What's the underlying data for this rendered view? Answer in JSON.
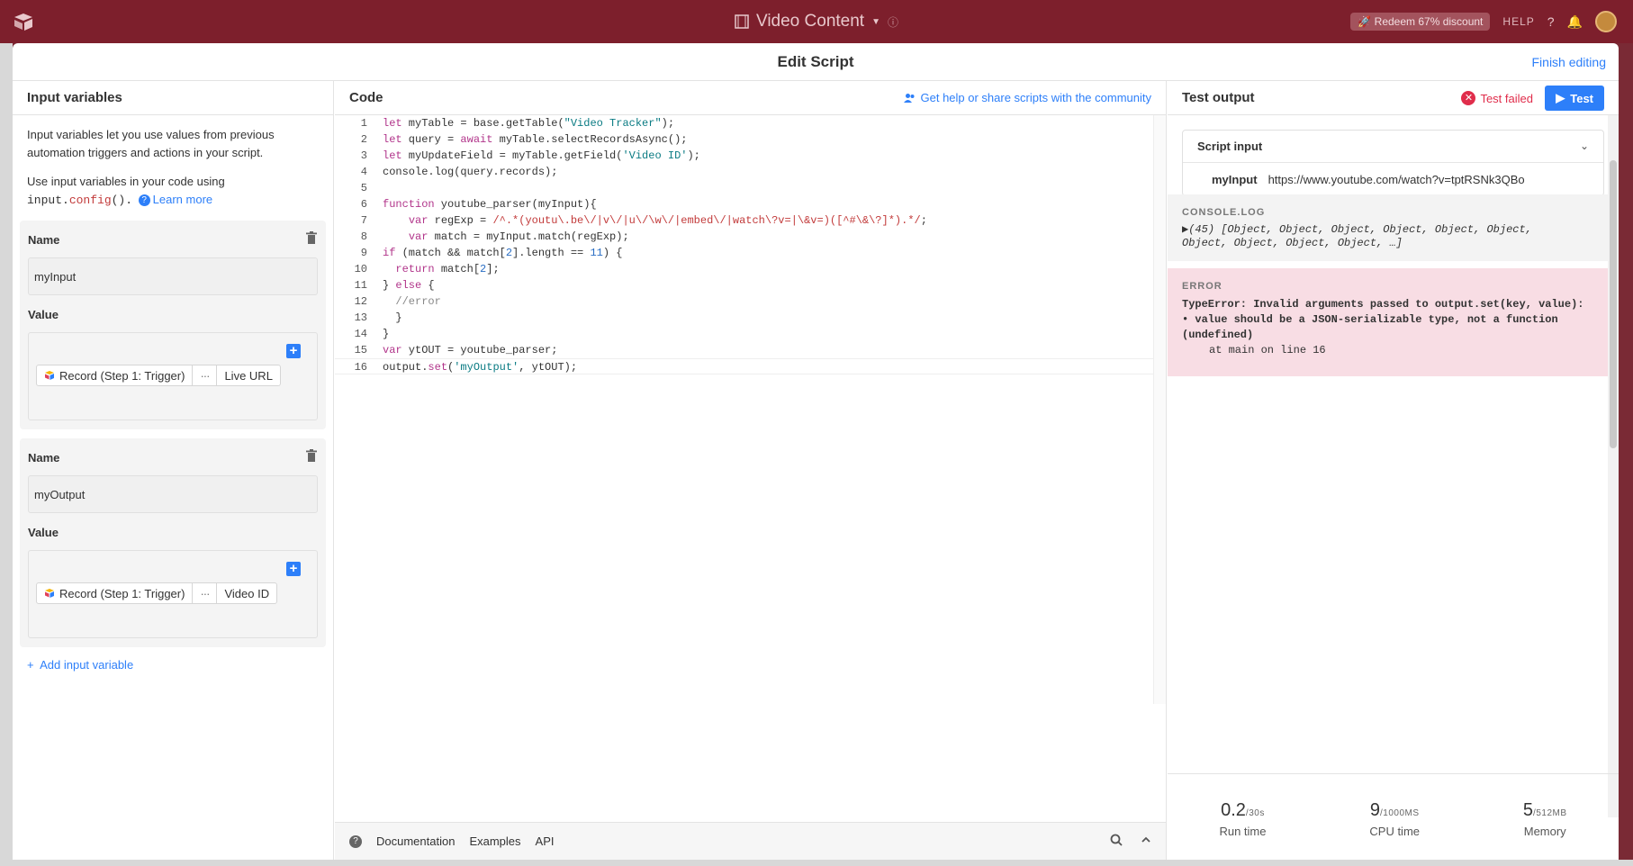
{
  "topbar": {
    "base_title": "Video Content",
    "redeem_label": "Redeem 67% discount",
    "help_label": "HELP"
  },
  "modal": {
    "title": "Edit Script",
    "finish_label": "Finish editing"
  },
  "input_variables": {
    "header": "Input variables",
    "intro_1": "Input variables let you use values from previous automation triggers and actions in your script.",
    "intro_2_prefix": "Use input variables in your code using",
    "intro_2_code_a": "input.",
    "intro_2_code_b": "config",
    "intro_2_code_c": "().",
    "learn_more": "Learn more",
    "name_label": "Name",
    "value_label": "Value",
    "variables": [
      {
        "name": "myInput",
        "record": "Record (Step 1: Trigger)",
        "dots": "···",
        "field": "Live URL"
      },
      {
        "name": "myOutput",
        "record": "Record (Step 1: Trigger)",
        "dots": "···",
        "field": "Video ID"
      }
    ],
    "add_label": "Add input variable"
  },
  "code": {
    "header": "Code",
    "help_link": "Get help or share scripts with the community",
    "footer": {
      "documentation": "Documentation",
      "examples": "Examples",
      "api": "API"
    }
  },
  "test_output": {
    "header": "Test output",
    "status": "Test failed",
    "test_button": "Test",
    "script_input_label": "Script input",
    "input_key": "myInput",
    "input_value": "https://www.youtube.com/watch?v=tptRSNk3QBo",
    "console_label": "CONSOLE.LOG",
    "console_text_1": "▶(45) [Object, Object, Object, Object, Object, Object,",
    "console_text_2": "Object, Object, Object, Object, …]",
    "error_label": "ERROR",
    "error_line_1": "TypeError: Invalid arguments passed to output.set(key, value):",
    "error_line_2": "• value should be a JSON-serializable type, not a function",
    "error_line_3": "(undefined)",
    "error_line_4": "at main on line 16",
    "stats": [
      {
        "value": "0.2",
        "max": "/30s",
        "label": "Run time"
      },
      {
        "value": "9",
        "max": "/1000MS",
        "label": "CPU time"
      },
      {
        "value": "5",
        "max": "/512MB",
        "label": "Memory"
      }
    ]
  },
  "colors": {
    "accent": "#2d7ff9",
    "error": "#e02d4b",
    "topbar": "#7d1f2c"
  }
}
